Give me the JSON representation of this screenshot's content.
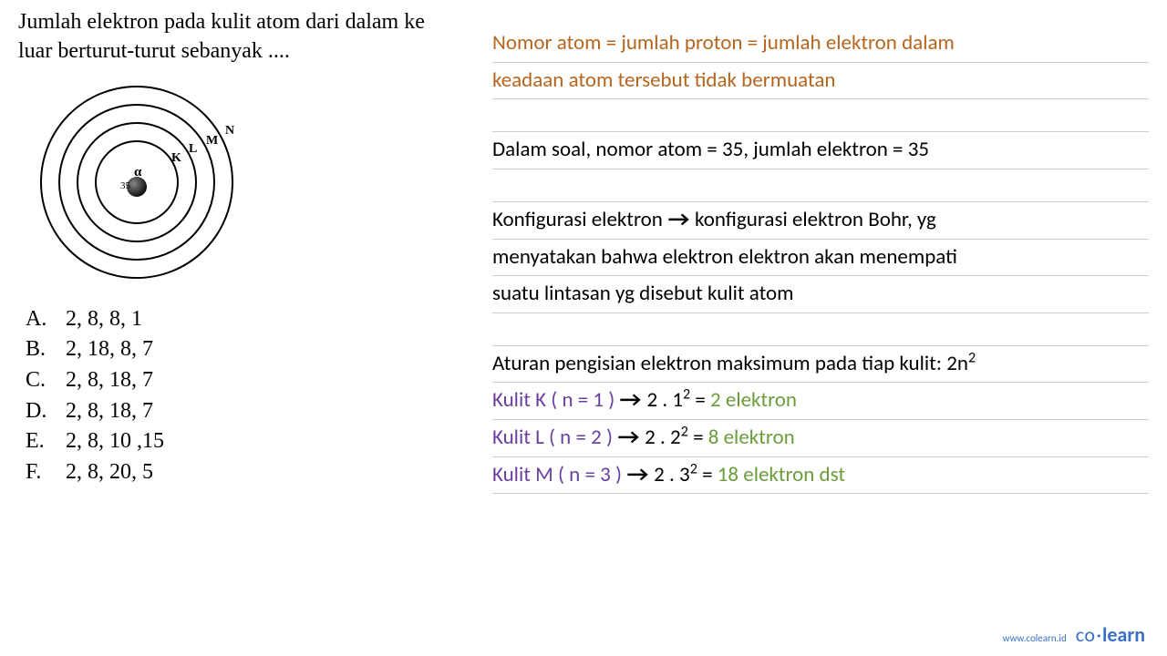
{
  "question": {
    "line1": "Jumlah elektron pada kulit atom dari dalam ke",
    "line2": "luar berturut-turut sebanyak ...."
  },
  "diagram": {
    "shells": [
      "K",
      "L",
      "M",
      "N"
    ],
    "nucleus_label_top": "α",
    "nucleus_label_left": "35"
  },
  "options": [
    {
      "letter": "A.",
      "text": "2, 8, 8, 1"
    },
    {
      "letter": "B.",
      "text": "2, 18, 8, 7"
    },
    {
      "letter": "C.",
      "text": "2, 8, 18, 7"
    },
    {
      "letter": "D.",
      "text": "2, 8, 18, 7"
    },
    {
      "letter": "E.",
      "text": "2, 8, 10 ,15"
    },
    {
      "letter": "F.",
      "text": "2, 8, 20, 5"
    }
  ],
  "explanation": {
    "l1": "Nomor atom = jumlah proton = jumlah elektron dalam",
    "l2": "keadaan atom tersebut tidak bermuatan",
    "l3": "Dalam soal, nomor atom = 35, jumlah elektron = 35",
    "l4a": "Konfigurasi elektron ",
    "l4b": " konfigurasi elektron Bohr, yg",
    "l5": "menyatakan bahwa elektron elektron akan menempati",
    "l6": "suatu lintasan yg disebut kulit atom",
    "l7a": "Aturan pengisian elektron maksimum pada tiap kulit: 2n",
    "l7b": "2",
    "k_label": "Kulit K ( n = 1 ) ",
    "k_calc": " 2 . 1",
    "k_exp": "2",
    "k_eq": " = ",
    "k_result": "2 elektron",
    "l_label": "Kulit L ( n = 2 ) ",
    "l_calc": " 2 . 2",
    "l_exp": "2",
    "l_eq": " = ",
    "l_result": "8 elektron",
    "m_label": "Kulit M ( n = 3 ) ",
    "m_calc": " 2 . 3",
    "m_exp": "2",
    "m_eq": " = ",
    "m_result": "18 elektron dst"
  },
  "footer": {
    "url": "www.colearn.id",
    "logo_co": "co",
    "logo_dot": "·",
    "logo_learn": "learn"
  },
  "chart_data": {
    "type": "diagram",
    "description": "Bohr atom model with 4 concentric shells labeled K L M N from inside out, nucleus marked with 35 and alpha symbol",
    "shells": [
      "K",
      "L",
      "M",
      "N"
    ],
    "nucleus_number": 35
  }
}
